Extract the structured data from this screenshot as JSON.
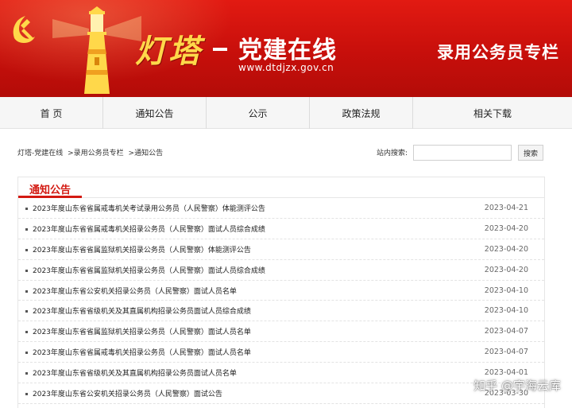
{
  "banner": {
    "logo_chars": "灯塔",
    "subtitle": "党建在线",
    "url": "www.dtdjzx.gov.cn",
    "column_title": "录用公务员专栏"
  },
  "nav": {
    "items": [
      {
        "label": "首 页"
      },
      {
        "label": "通知公告"
      },
      {
        "label": "公示"
      },
      {
        "label": "政策法规"
      },
      {
        "label": "相关下载"
      }
    ]
  },
  "breadcrumb": {
    "items": [
      "灯塔-党建在线",
      ">录用公务员专栏",
      ">通知公告"
    ]
  },
  "search": {
    "label": "站内搜索:",
    "value": "",
    "button": "搜索"
  },
  "panel": {
    "title": "通知公告"
  },
  "news": [
    {
      "title": "2023年度山东省省属戒毒机关考试录用公务员（人民警察）体能测评公告",
      "date": "2023-04-21"
    },
    {
      "title": "2023年度山东省省属戒毒机关招录公务员（人民警察）面试人员综合成绩",
      "date": "2023-04-20"
    },
    {
      "title": "2023年度山东省省属监狱机关招录公务员（人民警察）体能测评公告",
      "date": "2023-04-20"
    },
    {
      "title": "2023年度山东省省属监狱机关招录公务员（人民警察）面试人员综合成绩",
      "date": "2023-04-20"
    },
    {
      "title": "2023年度山东省公安机关招录公务员（人民警察）面试人员名单",
      "date": "2023-04-10"
    },
    {
      "title": "2023年度山东省省级机关及其直属机构招录公务员面试人员综合成绩",
      "date": "2023-04-10"
    },
    {
      "title": "2023年度山东省省属监狱机关招录公务员（人民警察）面试人员名单",
      "date": "2023-04-07"
    },
    {
      "title": "2023年度山东省省属戒毒机关招录公务员（人民警察）面试人员名单",
      "date": "2023-04-07"
    },
    {
      "title": "2023年度山东省省级机关及其直属机构招录公务员面试人员名单",
      "date": "2023-04-01"
    },
    {
      "title": "2023年度山东省公安机关招录公务员（人民警察）面试公告",
      "date": "2023-03-30"
    }
  ],
  "watermark": "知乎 @宇海云库",
  "colors": {
    "banner_red": "#c70f0b",
    "accent_red": "#d31a12",
    "logo_gold": "#ffd84a"
  },
  "icons": {
    "emblem": "party-emblem-icon",
    "lighthouse": "lighthouse-icon"
  }
}
